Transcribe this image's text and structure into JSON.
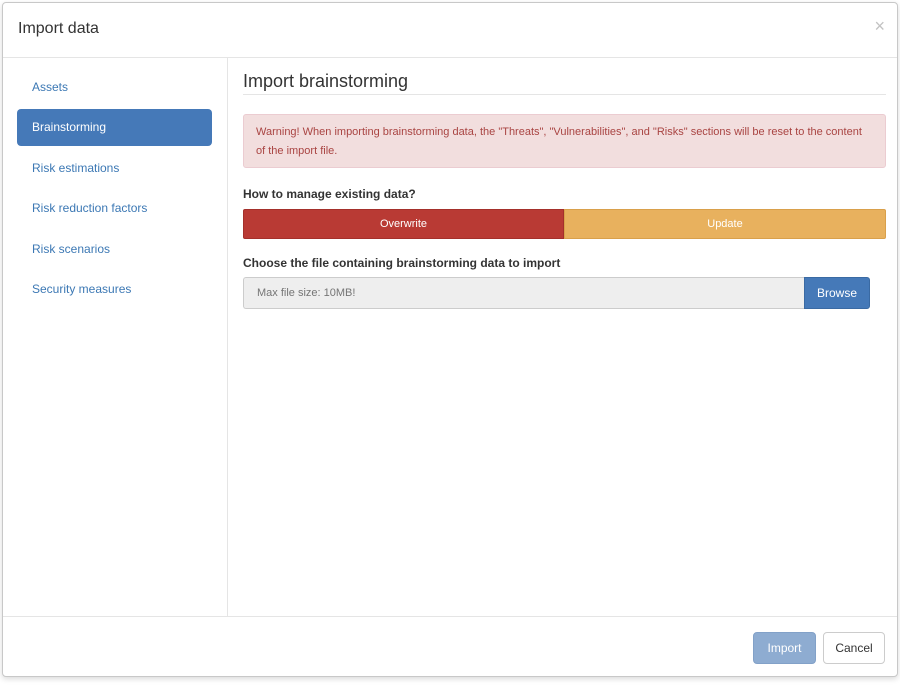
{
  "dialog": {
    "title": "Import data",
    "close_label": "×"
  },
  "sidebar": {
    "items": [
      {
        "label": "Assets",
        "active": false
      },
      {
        "label": "Brainstorming",
        "active": true
      },
      {
        "label": "Risk estimations",
        "active": false
      },
      {
        "label": "Risk reduction factors",
        "active": false
      },
      {
        "label": "Risk scenarios",
        "active": false
      },
      {
        "label": "Security measures",
        "active": false
      }
    ]
  },
  "main": {
    "title": "Import brainstorming",
    "warning": "Warning! When importing brainstorming data, the \"Threats\", \"Vulnerabilities\", and \"Risks\" sections will be reset to the content of the import file.",
    "manage_label": "How to manage existing data?",
    "overwrite_label": "Overwrite",
    "update_label": "Update",
    "file_label": "Choose the file containing brainstorming data to import",
    "file_placeholder": "Max file size: 10MB!",
    "browse_label": "Browse"
  },
  "footer": {
    "import_label": "Import",
    "cancel_label": "Cancel"
  },
  "colors": {
    "primary": "#4579b8",
    "danger": "#b93a34",
    "warning": "#e8b15e",
    "alert_bg": "#f2dede",
    "alert_text": "#a94442"
  }
}
